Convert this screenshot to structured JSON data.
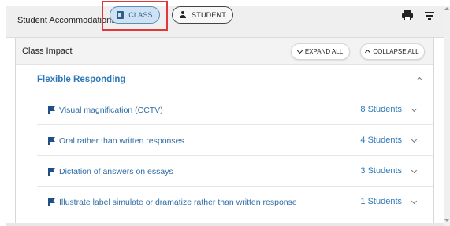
{
  "topbar": {
    "title": "Student Accommodations",
    "class_label": "CLASS",
    "student_label": "STUDENT",
    "icons": [
      "book-icon",
      "person-icon",
      "print-icon",
      "filter-icon"
    ]
  },
  "panel": {
    "title": "Class Impact",
    "expand_label": "EXPAND ALL",
    "collapse_label": "COLLAPSE ALL"
  },
  "group": {
    "title": "Flexible Responding",
    "items": [
      {
        "label": "Visual magnification (CCTV)",
        "count": "8 Students"
      },
      {
        "label": "Oral rather than written responses",
        "count": "4 Students"
      },
      {
        "label": "Dictation of answers on essays",
        "count": "3 Students"
      },
      {
        "label": "Illustrate label simulate or dramatize rather than written response",
        "count": "1 Students"
      }
    ]
  },
  "colors": {
    "accent": "#2e78b7",
    "highlight": "#e0383a",
    "toggle_active_bg": "#cfe2f3"
  }
}
